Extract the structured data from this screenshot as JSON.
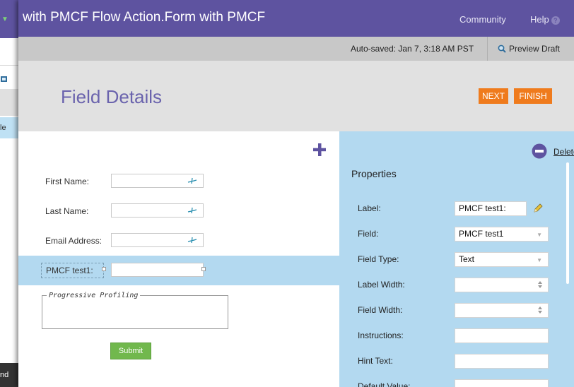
{
  "behind": {
    "label_fragment": "le",
    "bottom_fragment": "nd"
  },
  "window": {
    "title": "with PMCF Flow Action.Form with PMCF",
    "community": "Community",
    "help": "Help"
  },
  "savebar": {
    "autosaved": "Auto-saved: Jan 7, 3:18 AM PST",
    "preview": "Preview Draft"
  },
  "header": {
    "title": "Field Details",
    "next": "NEXT",
    "finish": "FINISH"
  },
  "form": {
    "fields": [
      {
        "label": "First Name:"
      },
      {
        "label": "Last Name:"
      },
      {
        "label": "Email Address:"
      }
    ],
    "selected_label": "PMCF test1:",
    "progressive_profiling": "Progressive Profiling",
    "submit": "Submit"
  },
  "properties": {
    "delete": "Delete",
    "title": "Properties",
    "rows": [
      {
        "label": "Label:",
        "value": "PMCF test1:"
      },
      {
        "label": "Field:",
        "value": "PMCF test1"
      },
      {
        "label": "Field Type:",
        "value": "Text"
      },
      {
        "label": "Label Width:",
        "value": ""
      },
      {
        "label": "Field Width:",
        "value": ""
      },
      {
        "label": "Instructions:",
        "value": ""
      },
      {
        "label": "Hint Text:",
        "value": ""
      },
      {
        "label": "Default Value:",
        "value": ""
      }
    ]
  },
  "colors": {
    "brand": "#5e53a0",
    "accent": "#ef7b1d",
    "panel": "#b3d9f0",
    "submit": "#71b84d"
  }
}
